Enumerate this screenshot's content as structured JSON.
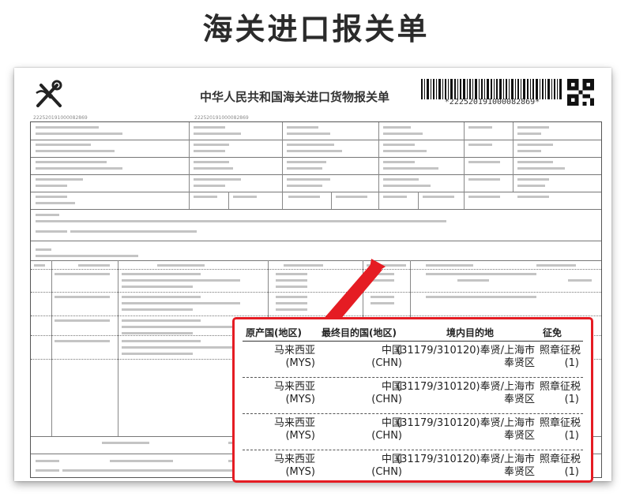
{
  "page_title": "海关进口报关单",
  "document": {
    "title": "中华人民共和国海关进口货物报关单",
    "barcode_number": "*222520191000082869*",
    "prerecord_no": "222520191000082869",
    "customs_no": "222520191000082869"
  },
  "zoom": {
    "headers": {
      "origin": "原产国(地区)",
      "destination": "最终目的国(地区)",
      "domestic": "境内目的地",
      "tax": "征免"
    },
    "rows": [
      {
        "origin_cn": "马来西亚",
        "origin_code": "(MYS)",
        "dest_cn": "中国",
        "dest_code": "(CHN)",
        "domestic_line1": "(31179/310120)奉贤/上海市",
        "domestic_line2": "奉贤区",
        "tax_line1": "照章征税",
        "tax_line2": "(1)"
      },
      {
        "origin_cn": "马来西亚",
        "origin_code": "(MYS)",
        "dest_cn": "中国",
        "dest_code": "(CHN)",
        "domestic_line1": "(31179/310120)奉贤/上海市",
        "domestic_line2": "奉贤区",
        "tax_line1": "照章征税",
        "tax_line2": "(1)"
      },
      {
        "origin_cn": "马来西亚",
        "origin_code": "(MYS)",
        "dest_cn": "中国",
        "dest_code": "(CHN)",
        "domestic_line1": "(31179/310120)奉贤/上海市",
        "domestic_line2": "奉贤区",
        "tax_line1": "照章征税",
        "tax_line2": "(1)"
      },
      {
        "origin_cn": "马来西亚",
        "origin_code": "(MYS)",
        "dest_cn": "中国",
        "dest_code": "(CHN)",
        "domestic_line1": "(31179/310120)奉贤/上海市",
        "domestic_line2": "奉贤区",
        "tax_line1": "照章征税",
        "tax_line2": "(1)"
      }
    ]
  },
  "colors": {
    "accent": "#e51c23"
  }
}
